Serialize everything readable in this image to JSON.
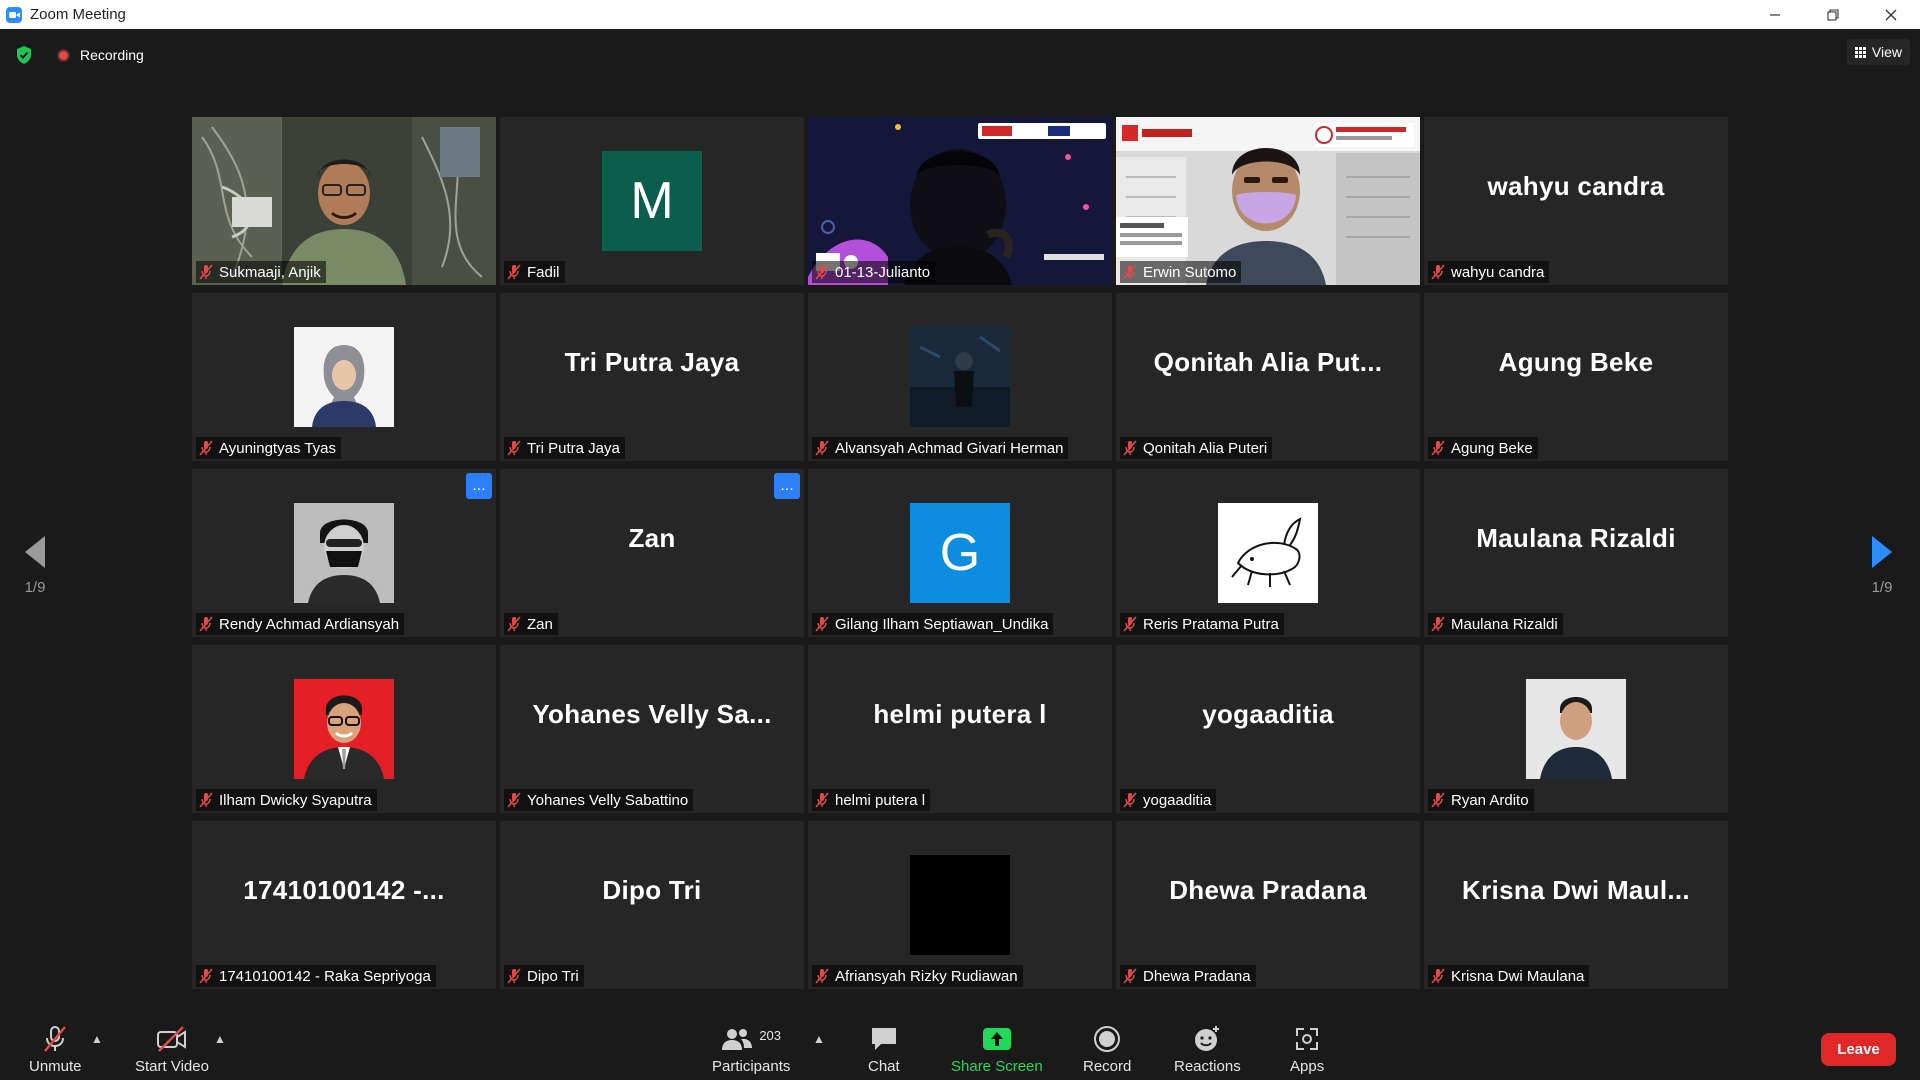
{
  "window": {
    "title": "Zoom Meeting"
  },
  "topbar": {
    "recording_label": "Recording",
    "view_label": "View"
  },
  "pager": {
    "left": "1/9",
    "right": "1/9"
  },
  "tiles": [
    {
      "name": "Sukmaaji, Anjik",
      "big": "",
      "avatar": "video-room"
    },
    {
      "name": "Fadil",
      "big": "",
      "avatar": "letter",
      "letter": "M",
      "color": "#0b5e4e"
    },
    {
      "name": "01-13-Julianto",
      "big": "",
      "avatar": "video-webinar"
    },
    {
      "name": "Erwin Sutomo",
      "big": "",
      "avatar": "video-dinamika"
    },
    {
      "name": "wahyu candra",
      "big": "wahyu candra"
    },
    {
      "name": "Ayuningtyas Tyas",
      "big": "",
      "avatar": "photo-hijab"
    },
    {
      "name": "Tri Putra Jaya",
      "big": "Tri Putra Jaya"
    },
    {
      "name": "Alvansyah Achmad Givari Herman",
      "big": "",
      "avatar": "photo-dark"
    },
    {
      "name": "Qonitah Alia Puteri",
      "big": "Qonitah  Alia  Put..."
    },
    {
      "name": "Agung Beke",
      "big": "Agung Beke"
    },
    {
      "name": "Rendy Achmad Ardiansyah",
      "big": "",
      "avatar": "photo-mask",
      "menu": "..."
    },
    {
      "name": "Zan",
      "big": "Zan",
      "menu": "..."
    },
    {
      "name": "Gilang Ilham Septiawan_Undika",
      "big": "",
      "avatar": "letter",
      "letter": "G",
      "color": "#0e8de0"
    },
    {
      "name": "Reris Pratama Putra",
      "big": "",
      "avatar": "photo-sketch"
    },
    {
      "name": "Maulana Rizaldi",
      "big": "Maulana Rizaldi"
    },
    {
      "name": "Ilham Dwicky Syaputra",
      "big": "",
      "avatar": "photo-red"
    },
    {
      "name": "Yohanes Velly Sabattino",
      "big": "Yohanes  Velly  Sa..."
    },
    {
      "name": "helmi putera l",
      "big": "helmi putera l"
    },
    {
      "name": "yogaaditia",
      "big": "yogaaditia"
    },
    {
      "name": "Ryan Ardito",
      "big": "",
      "avatar": "photo-light"
    },
    {
      "name": "17410100142 - Raka Sepriyoga",
      "big": "17410100142  -..."
    },
    {
      "name": "Dipo Tri",
      "big": "Dipo Tri"
    },
    {
      "name": "Afriansyah Rizky Rudiawan",
      "big": "",
      "avatar": "black"
    },
    {
      "name": "Dhewa Pradana",
      "big": "Dhewa Pradana"
    },
    {
      "name": "Krisna Dwi Maulana",
      "big": "Krisna  Dwi  Maul..."
    }
  ],
  "toolbar": {
    "unmute": "Unmute",
    "start_video": "Start Video",
    "participants_count": "203",
    "participants": "Participants",
    "chat": "Chat",
    "share_screen": "Share Screen",
    "record": "Record",
    "reactions": "Reactions",
    "apps": "Apps",
    "leave": "Leave"
  },
  "colors": {
    "accent": "#2d8cff",
    "share": "#23d959",
    "leave": "#e02828",
    "active_speaker": "#e8e84a",
    "muted": "#e24a4a"
  }
}
